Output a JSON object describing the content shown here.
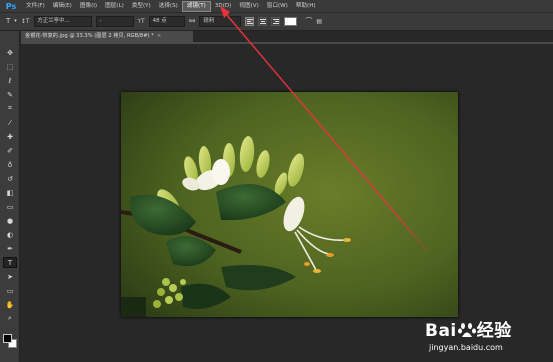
{
  "app": {
    "logo": "Ps"
  },
  "menu": [
    {
      "label": "文件(F)",
      "name": "menu-file"
    },
    {
      "label": "编辑(E)",
      "name": "menu-edit"
    },
    {
      "label": "图像(I)",
      "name": "menu-image"
    },
    {
      "label": "图层(L)",
      "name": "menu-layer"
    },
    {
      "label": "类型(Y)",
      "name": "menu-type"
    },
    {
      "label": "选择(S)",
      "name": "menu-select"
    },
    {
      "label": "滤镜(T)",
      "name": "menu-filter"
    },
    {
      "label": "3D(D)",
      "name": "menu-3d"
    },
    {
      "label": "视图(V)",
      "name": "menu-view"
    },
    {
      "label": "窗口(W)",
      "name": "menu-window"
    },
    {
      "label": "帮助(H)",
      "name": "menu-help"
    }
  ],
  "options": {
    "tool_glyph": "T",
    "font_family": "方正兰亭中...",
    "font_style": "-",
    "font_size": "48 点",
    "aa_label": "aa",
    "antialias": "锐利",
    "text_color": "#ffffff"
  },
  "document": {
    "tab_title": "金银花-恢复的.jpg @ 33.3% (图层 2 拷贝, RGB/8#) *",
    "close_glyph": "×"
  },
  "toolbar": {
    "icons": [
      "move-icon",
      "marquee-icon",
      "lasso-icon",
      "quick-select-icon",
      "crop-icon",
      "eyedropper-icon",
      "healing-icon",
      "brush-icon",
      "clone-stamp-icon",
      "history-brush-icon",
      "eraser-icon",
      "gradient-icon",
      "blur-icon",
      "dodge-icon",
      "pen-icon",
      "type-icon",
      "path-select-icon",
      "rectangle-icon",
      "hand-icon",
      "zoom-icon"
    ],
    "selected": "type-icon",
    "foreground_color": "#000000",
    "background_color": "#ffffff"
  },
  "annotation": {
    "arrow_color": "#e8323c"
  },
  "watermark": {
    "logo_pre": "Bai",
    "logo_post": "经验",
    "url": "jingyan.baidu.com"
  }
}
